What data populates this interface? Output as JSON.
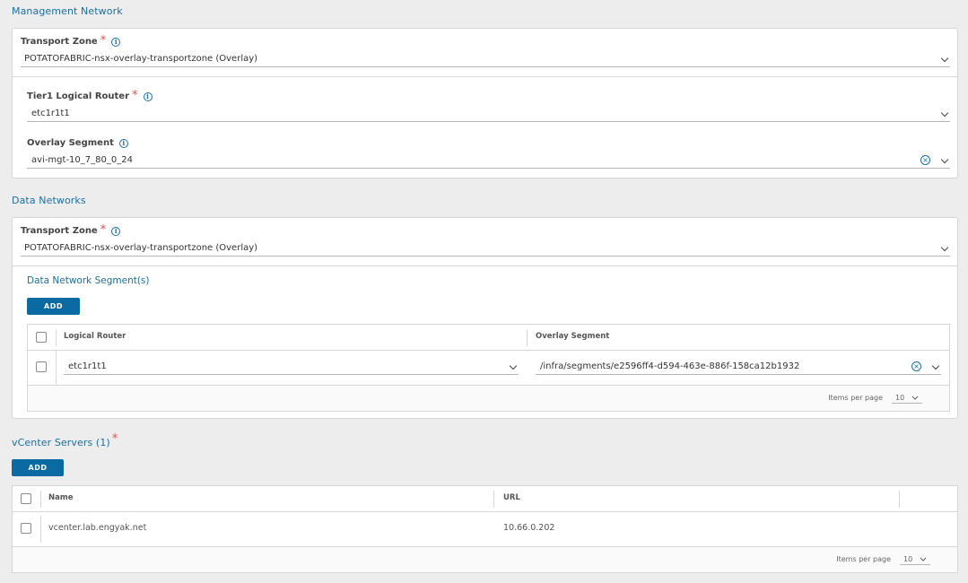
{
  "management": {
    "title": "Management Network",
    "transport_zone_label": "Transport Zone",
    "transport_zone_value": "POTATOFABRIC-nsx-overlay-transportzone (Overlay)",
    "tier1_label": "Tier1 Logical Router",
    "tier1_value": "etc1r1t1",
    "overlay_label": "Overlay Segment",
    "overlay_value": "avi-mgt-10_7_80_0_24"
  },
  "data_networks": {
    "title": "Data Networks",
    "transport_zone_label": "Transport Zone",
    "transport_zone_value": "POTATOFABRIC-nsx-overlay-transportzone (Overlay)",
    "segments_title": "Data Network Segment(s)",
    "add_label": "ADD",
    "columns": [
      "Logical Router",
      "Overlay Segment"
    ],
    "rows": [
      {
        "router": "etc1r1t1",
        "segment": "/infra/segments/e2596ff4-d594-463e-886f-158ca12b1932"
      }
    ],
    "items_per_page_label": "Items per page",
    "items_per_page_value": "10"
  },
  "vcenter": {
    "title": "vCenter Servers (1)",
    "add_label": "ADD",
    "columns": [
      "Name",
      "URL"
    ],
    "rows": [
      {
        "name": "vcenter.lab.engyak.net",
        "url": "10.66.0.202"
      }
    ],
    "items_per_page_label": "Items per page",
    "items_per_page_value": "10"
  },
  "colors": {
    "accent": "#1a6fa3",
    "button": "#0a6aa1",
    "required": "#d9534f",
    "background": "#ededed"
  },
  "icons": {
    "info": "info-icon",
    "chevron": "chevron-down-icon",
    "clear": "clear-icon"
  },
  "glyphs": {
    "required": "*",
    "info": "i",
    "clear": "×"
  }
}
